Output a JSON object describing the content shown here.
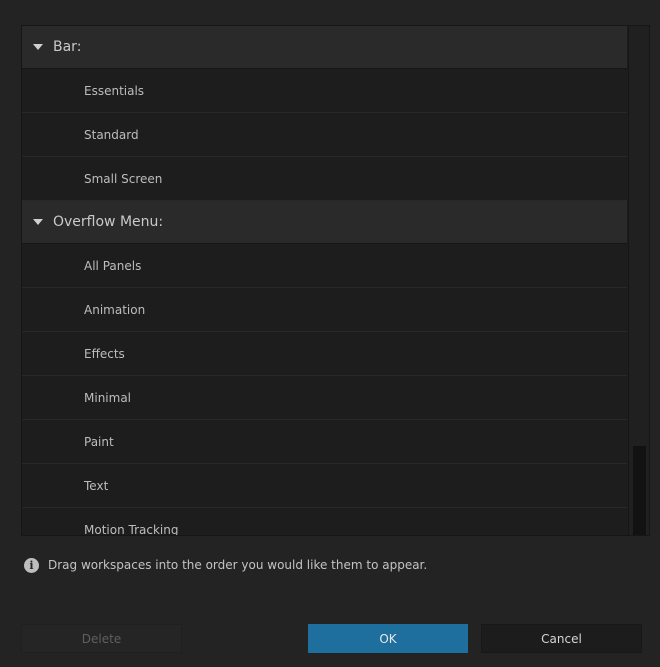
{
  "groups": [
    {
      "label": "Bar:",
      "items": [
        "Essentials",
        "Standard",
        "Small Screen"
      ]
    },
    {
      "label": "Overflow Menu:",
      "items": [
        "All Panels",
        "Animation",
        "Effects",
        "Minimal",
        "Paint",
        "Text",
        "Motion Tracking"
      ]
    }
  ],
  "info": {
    "icon": "info-icon",
    "text": "Drag workspaces into the order you would like them to appear."
  },
  "buttons": {
    "delete": "Delete",
    "ok": "OK",
    "cancel": "Cancel"
  },
  "colors": {
    "accent": "#1f6f9e",
    "background": "#232323"
  }
}
